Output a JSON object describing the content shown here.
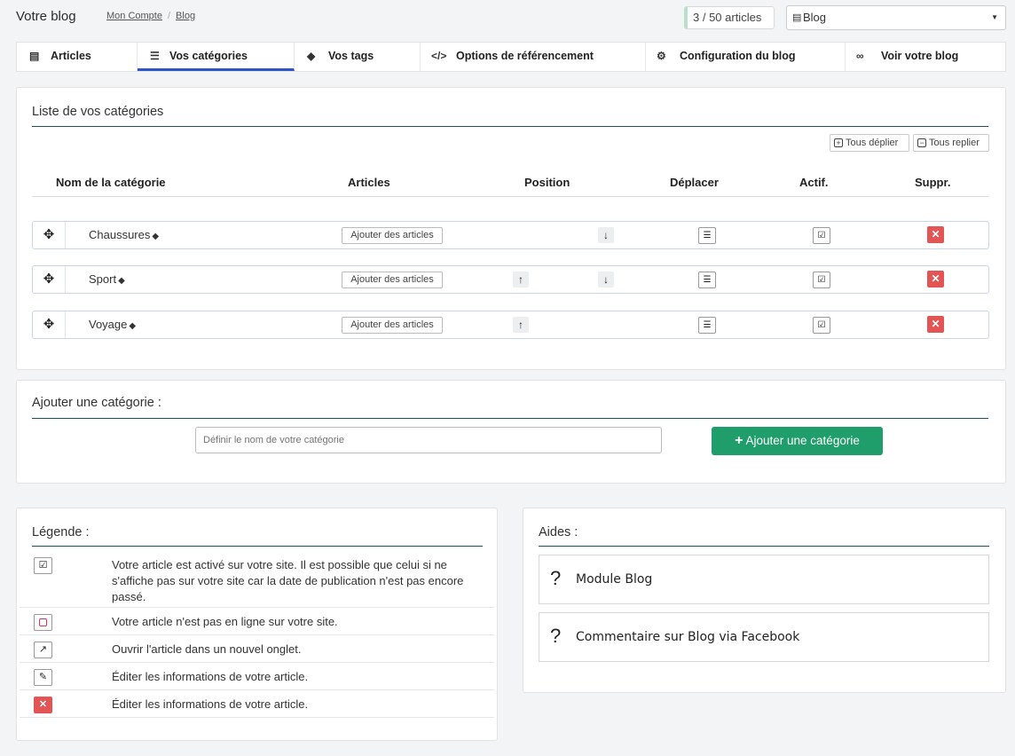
{
  "header": {
    "title": "Votre blog",
    "breadcrumbs": [
      "Mon Compte",
      "Blog"
    ],
    "article_count": "3 / 50 articles",
    "blog_select": "Blog"
  },
  "tabs": [
    {
      "label": "Articles",
      "icon": "newspaper-icon"
    },
    {
      "label": "Vos catégories",
      "icon": "list-icon",
      "active": true
    },
    {
      "label": "Vos tags",
      "icon": "tags-icon"
    },
    {
      "label": "Options de référencement",
      "icon": "code-icon"
    },
    {
      "label": "Configuration du blog",
      "icon": "gear-icon"
    },
    {
      "label": "Voir votre blog",
      "icon": "link-icon"
    }
  ],
  "categories_card": {
    "title": "Liste de vos catégories",
    "expand_all": "Tous déplier",
    "collapse_all": "Tous replier",
    "columns": [
      "Nom de la catégorie",
      "Articles",
      "Position",
      "Déplacer",
      "Actif.",
      "Suppr."
    ],
    "add_articles_label": "Ajouter des articles",
    "rows": [
      {
        "name": "Chaussures",
        "up": false,
        "down": true,
        "active": true
      },
      {
        "name": "Sport",
        "up": true,
        "down": true,
        "active": true
      },
      {
        "name": "Voyage",
        "up": true,
        "down": false,
        "active": true
      }
    ]
  },
  "add_card": {
    "title": "Ajouter une catégorie :",
    "placeholder": "Définir le nom de votre catégorie",
    "button": "Ajouter une catégorie"
  },
  "legend": {
    "title": "Légende :",
    "items": [
      {
        "icon": "checkbox-checked-icon",
        "text": "Votre article est activé sur votre site. Il est possible que celui si ne s'affiche pas sur votre site car la date de publication n'est pas encore passé."
      },
      {
        "icon": "checkbox-empty-icon",
        "text": "Votre article n'est pas en ligne sur votre site."
      },
      {
        "icon": "external-link-icon",
        "text": "Ouvrir l'article dans un nouvel onglet."
      },
      {
        "icon": "pencil-icon",
        "text": "Éditer les informations de votre article."
      },
      {
        "icon": "delete-icon",
        "text": "Éditer les informations de votre article."
      }
    ]
  },
  "aides": {
    "title": "Aides :",
    "items": [
      "Module Blog",
      "Commentaire sur Blog via Facebook"
    ]
  },
  "colors": {
    "accent": "#2f55c9",
    "success": "#1f9d6a",
    "danger": "#e35454"
  }
}
